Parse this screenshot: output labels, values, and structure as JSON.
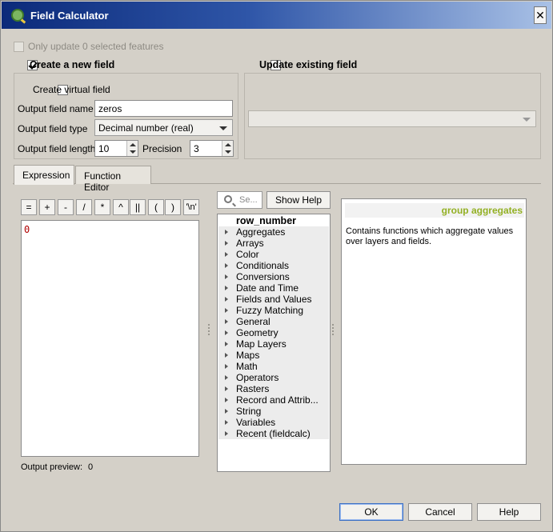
{
  "window": {
    "title": "Field Calculator",
    "close_glyph": "✕"
  },
  "top": {
    "only_update_label": "Only update 0 selected features",
    "create_new_field_label": "Create a new field",
    "update_existing_label": "Update existing field"
  },
  "new_field": {
    "create_virtual_label": "Create virtual field",
    "name_label": "Output field name",
    "name_value": "zeros",
    "type_label": "Output field type",
    "type_value": "Decimal number (real)",
    "length_label": "Output field length",
    "length_value": "10",
    "precision_label": "Precision",
    "precision_value": "3"
  },
  "existing_field": {
    "selected_value": ""
  },
  "tabs": [
    {
      "label": "Expression"
    },
    {
      "label": "Function Editor"
    }
  ],
  "operators": [
    "=",
    "+",
    "-",
    "/",
    "*",
    "^",
    "||",
    "(",
    ")",
    "'\\n'"
  ],
  "expression": {
    "text": "0",
    "preview_label": "Output preview:",
    "preview_value": "0"
  },
  "search": {
    "placeholder": "Se..."
  },
  "show_help_label": "Show Help",
  "function_tree": [
    {
      "label": "row_number",
      "type": "header"
    },
    {
      "label": "Aggregates",
      "type": "group"
    },
    {
      "label": "Arrays",
      "type": "group"
    },
    {
      "label": "Color",
      "type": "group"
    },
    {
      "label": "Conditionals",
      "type": "group"
    },
    {
      "label": "Conversions",
      "type": "group"
    },
    {
      "label": "Date and Time",
      "type": "group"
    },
    {
      "label": "Fields and Values",
      "type": "group"
    },
    {
      "label": "Fuzzy Matching",
      "type": "group"
    },
    {
      "label": "General",
      "type": "group"
    },
    {
      "label": "Geometry",
      "type": "group"
    },
    {
      "label": "Map Layers",
      "type": "group"
    },
    {
      "label": "Maps",
      "type": "group"
    },
    {
      "label": "Math",
      "type": "group"
    },
    {
      "label": "Operators",
      "type": "group"
    },
    {
      "label": "Rasters",
      "type": "group"
    },
    {
      "label": "Record and Attrib...",
      "type": "group"
    },
    {
      "label": "String",
      "type": "group"
    },
    {
      "label": "Variables",
      "type": "group"
    },
    {
      "label": "Recent (fieldcalc)",
      "type": "group"
    }
  ],
  "help": {
    "title": "group aggregates",
    "body": "Contains functions which aggregate values over layers and fields.",
    "accent": "#93b023"
  },
  "buttons": {
    "ok": "OK",
    "cancel": "Cancel",
    "help": "Help"
  },
  "colors": {
    "titlebar_start": "#0b2a7a",
    "titlebar_end": "#a9c1e6",
    "expression_text": "#b00000"
  },
  "icons": {
    "app": "qgis-logo-icon",
    "search": "search-icon",
    "close": "close-icon"
  }
}
